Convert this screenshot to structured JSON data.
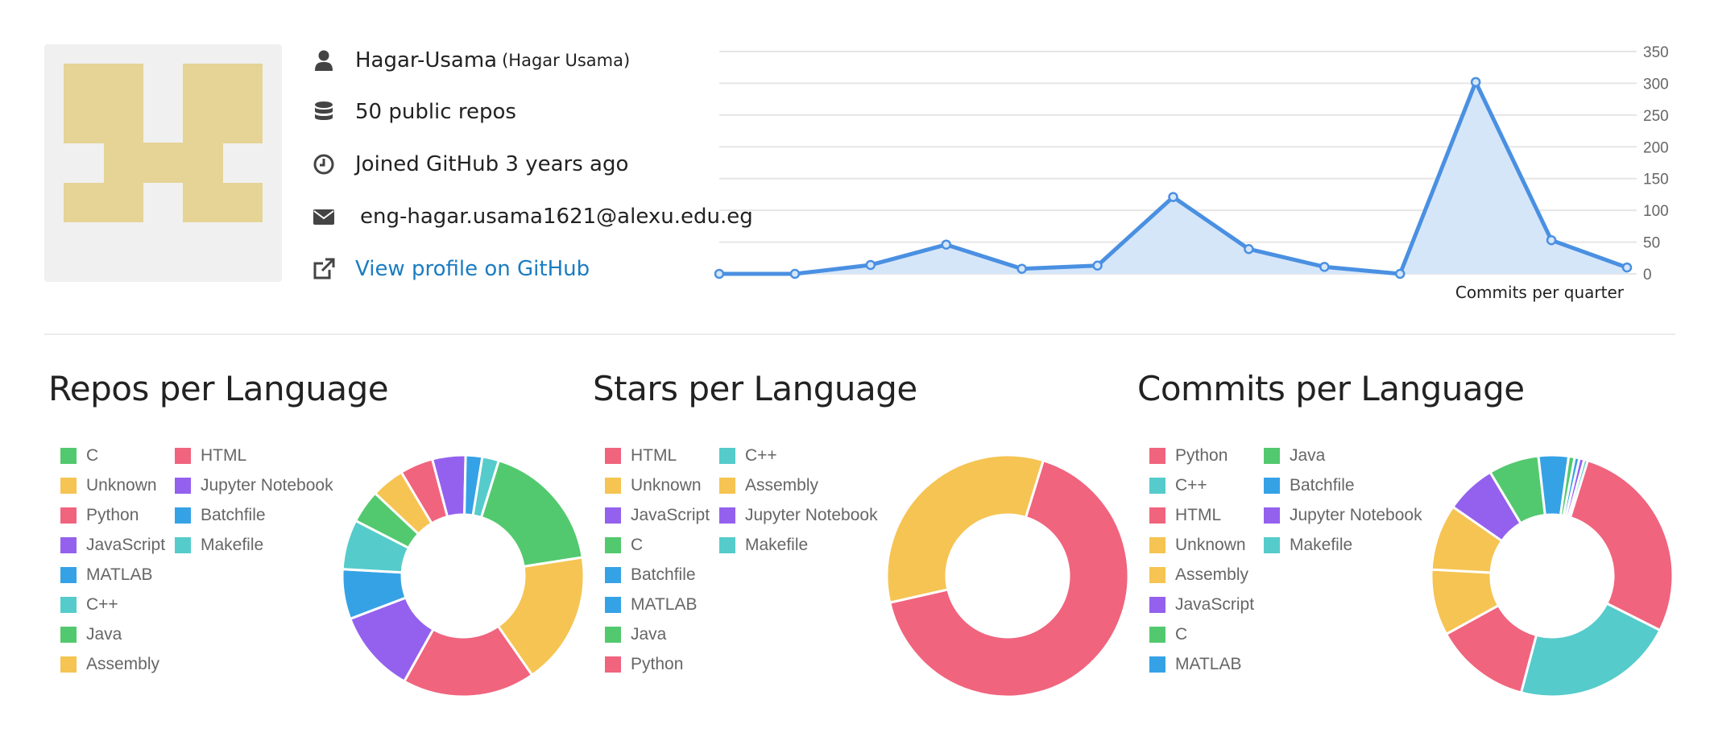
{
  "profile": {
    "username": "Hagar-Usama",
    "full_name": "(Hagar Usama)",
    "repos_text": "50 public repos",
    "joined_text": "Joined GitHub 3 years ago",
    "email": "eng-hagar.usama1621@alexu.edu.eg",
    "profile_link": "View profile on GitHub",
    "icons": [
      "user-icon",
      "database-icon",
      "clock-icon",
      "envelope-icon",
      "external-link-icon"
    ]
  },
  "colors": {
    "red": "#f0647e",
    "yellow": "#f5c452",
    "purple": "#9461ee",
    "blue": "#36a2e6",
    "teal": "#56cbcb",
    "green": "#53c96f",
    "line": "#4a90e2",
    "area": "#d6e6f9",
    "avatar": "#e6d496"
  },
  "chart_data": [
    {
      "type": "area",
      "title": "",
      "xlabel": "Commits per quarter",
      "ylabel": "",
      "ylim": [
        0,
        350
      ],
      "yticks": [
        "0",
        "50",
        "100",
        "150",
        "200",
        "250",
        "300",
        "350"
      ],
      "grid": true,
      "series": [
        {
          "values": [
            0,
            0,
            14,
            46,
            8,
            13,
            121,
            39,
            11,
            0,
            302,
            53,
            10
          ]
        }
      ]
    },
    {
      "type": "pie",
      "title": "Repos per Language",
      "legend": "left",
      "categories": [
        "C",
        "Unknown",
        "Python",
        "JavaScript",
        "MATLAB",
        "C++",
        "Java",
        "Assembly",
        "HTML",
        "Jupyter Notebook",
        "Batchfile",
        "Makefile"
      ],
      "colors": [
        "#53c96f",
        "#f5c452",
        "#f0647e",
        "#9461ee",
        "#36a2e6",
        "#56cbcb",
        "#53c96f",
        "#f5c452",
        "#f0647e",
        "#9461ee",
        "#36a2e6",
        "#56cbcb"
      ],
      "values": [
        8,
        8,
        8,
        5,
        3,
        3,
        2,
        2,
        2,
        2,
        1,
        1
      ]
    },
    {
      "type": "pie",
      "title": "Stars per Language",
      "legend": "left",
      "categories": [
        "HTML",
        "Unknown",
        "JavaScript",
        "C",
        "Batchfile",
        "MATLAB",
        "Java",
        "Python",
        "C++",
        "Assembly",
        "Jupyter Notebook",
        "Makefile"
      ],
      "colors": [
        "#f0647e",
        "#f5c452",
        "#9461ee",
        "#53c96f",
        "#36a2e6",
        "#36a2e6",
        "#53c96f",
        "#f0647e",
        "#56cbcb",
        "#f5c452",
        "#9461ee",
        "#56cbcb"
      ],
      "values": [
        2,
        1,
        0,
        0,
        0,
        0,
        0,
        0,
        0,
        0,
        0,
        0
      ]
    },
    {
      "type": "pie",
      "title": "Commits per Language",
      "legend": "left",
      "categories": [
        "Python",
        "C++",
        "HTML",
        "Unknown",
        "Assembly",
        "JavaScript",
        "C",
        "MATLAB",
        "Java",
        "Batchfile",
        "Jupyter Notebook",
        "Makefile"
      ],
      "colors": [
        "#f0647e",
        "#56cbcb",
        "#f0647e",
        "#f5c452",
        "#f5c452",
        "#9461ee",
        "#53c96f",
        "#36a2e6",
        "#53c96f",
        "#36a2e6",
        "#9461ee",
        "#56cbcb"
      ],
      "values": [
        172,
        135,
        80,
        55,
        55,
        42,
        42,
        25,
        5,
        4,
        4,
        3
      ]
    }
  ]
}
